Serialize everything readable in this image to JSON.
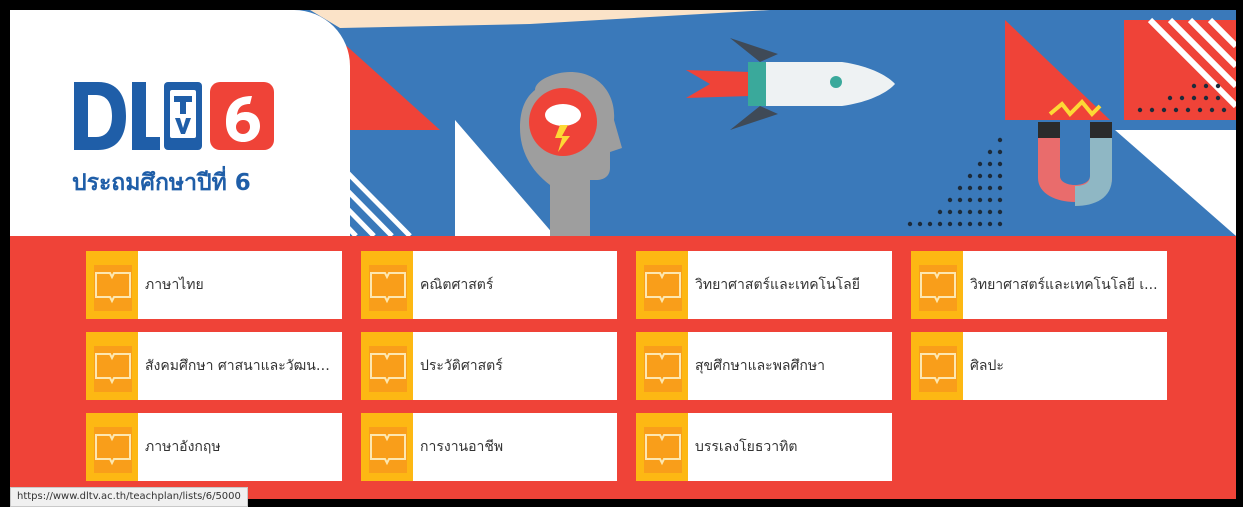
{
  "header": {
    "logo_letters": "DLTV",
    "logo_number": "6",
    "grade_label": "ประถมศึกษาปีที่ 6"
  },
  "subjects": [
    {
      "label": "ภาษาไทย"
    },
    {
      "label": "คณิตศาสตร์"
    },
    {
      "label": "วิทยาศาสตร์และเทคโนโลยี"
    },
    {
      "label": "วิทยาศาสตร์และเทคโนโลยี เ..."
    },
    {
      "label": "สังคมศึกษา ศาสนาและวัฒนธ..."
    },
    {
      "label": "ประวัติศาสตร์"
    },
    {
      "label": "สุขศึกษาและพลศึกษา"
    },
    {
      "label": "ศิลปะ"
    },
    {
      "label": "ภาษาอังกฤษ"
    },
    {
      "label": "การงานอาชีพ"
    },
    {
      "label": "บรรเลงโยธวาทิต"
    }
  ],
  "status_bar": {
    "url": "https://www.dltv.ac.th/teachplan/lists/6/5000"
  },
  "colors": {
    "brand_blue": "#1f5ea8",
    "banner_blue": "#3a79ba",
    "brand_red": "#ef4338",
    "card_icon_orange": "#fdb813"
  }
}
